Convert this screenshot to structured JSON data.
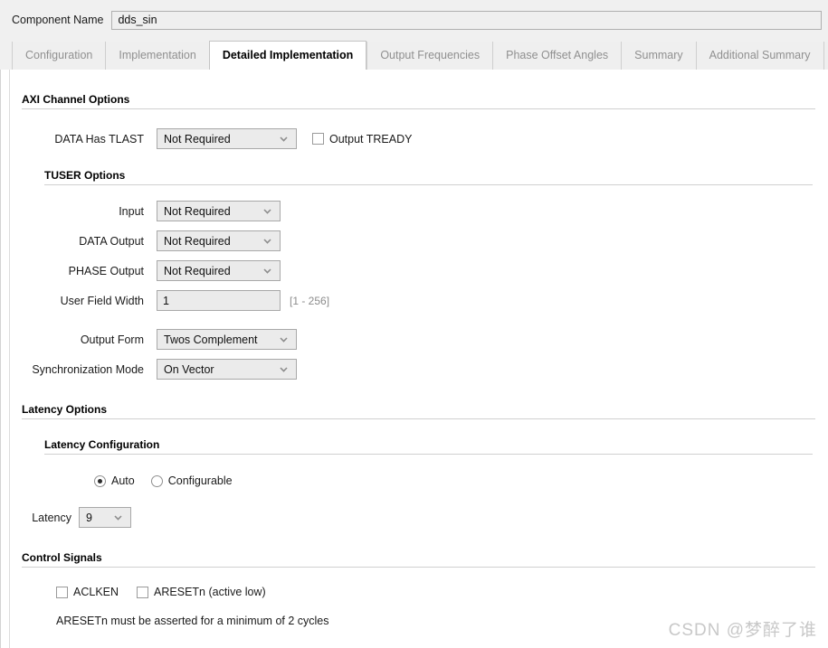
{
  "header": {
    "component_name_label": "Component Name",
    "component_name_value": "dds_sin"
  },
  "tabs": [
    {
      "label": "Configuration",
      "active": false
    },
    {
      "label": "Implementation",
      "active": false
    },
    {
      "label": "Detailed Implementation",
      "active": true
    },
    {
      "label": "Output Frequencies",
      "active": false
    },
    {
      "label": "Phase Offset Angles",
      "active": false
    },
    {
      "label": "Summary",
      "active": false
    },
    {
      "label": "Additional Summary",
      "active": false
    }
  ],
  "sections": {
    "axi": {
      "title": "AXI Channel Options",
      "data_has_tlast": {
        "label": "DATA Has TLAST",
        "value": "Not Required"
      },
      "output_tready": {
        "label": "Output TREADY",
        "checked": false
      },
      "tuser": {
        "title": "TUSER Options",
        "input": {
          "label": "Input",
          "value": "Not Required"
        },
        "data_output": {
          "label": "DATA Output",
          "value": "Not Required"
        },
        "phase_output": {
          "label": "PHASE Output",
          "value": "Not Required"
        },
        "user_field_width": {
          "label": "User Field Width",
          "value": "1",
          "range_hint": "[1 - 256]"
        }
      },
      "output_form": {
        "label": "Output Form",
        "value": "Twos Complement"
      },
      "sync_mode": {
        "label": "Synchronization Mode",
        "value": "On Vector"
      }
    },
    "latency": {
      "title": "Latency Options",
      "config": {
        "title": "Latency Configuration",
        "auto": {
          "label": "Auto",
          "selected": true
        },
        "configurable": {
          "label": "Configurable",
          "selected": false
        }
      },
      "latency": {
        "label": "Latency",
        "value": "9"
      }
    },
    "control": {
      "title": "Control Signals",
      "aclken": {
        "label": "ACLKEN",
        "checked": false
      },
      "aresetn": {
        "label": "ARESETn (active low)",
        "checked": false
      },
      "note": "ARESETn must be asserted for a minimum of 2 cycles"
    }
  },
  "watermark": "CSDN @梦醉了谁"
}
